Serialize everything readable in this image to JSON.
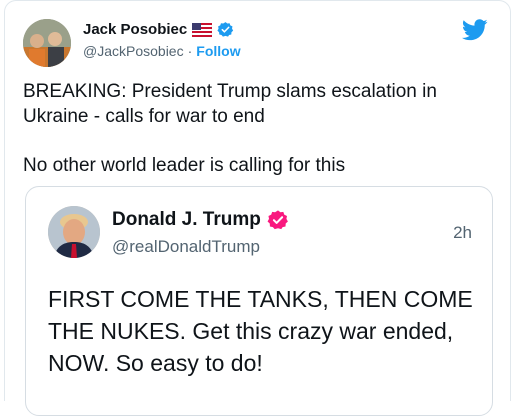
{
  "author": {
    "name": "Jack Posobiec",
    "handle": "@JackPosobiec",
    "separator": "·",
    "follow_label": "Follow",
    "verified_color": "#1d9bf0"
  },
  "tweet": {
    "line1": "BREAKING: President Trump slams escalation in Ukraine - calls for war to end",
    "line2": "No other world leader is calling for this"
  },
  "quoted": {
    "name": "Donald J. Trump",
    "handle": "@realDonaldTrump",
    "time": "2h",
    "text": "FIRST COME THE TANKS, THEN COME THE NUKES. Get this crazy war ended, NOW. So easy to do!",
    "verified_color": "#f9197f"
  },
  "icons": {
    "brand": "twitter-bird-icon",
    "flag": "us-flag-icon"
  }
}
